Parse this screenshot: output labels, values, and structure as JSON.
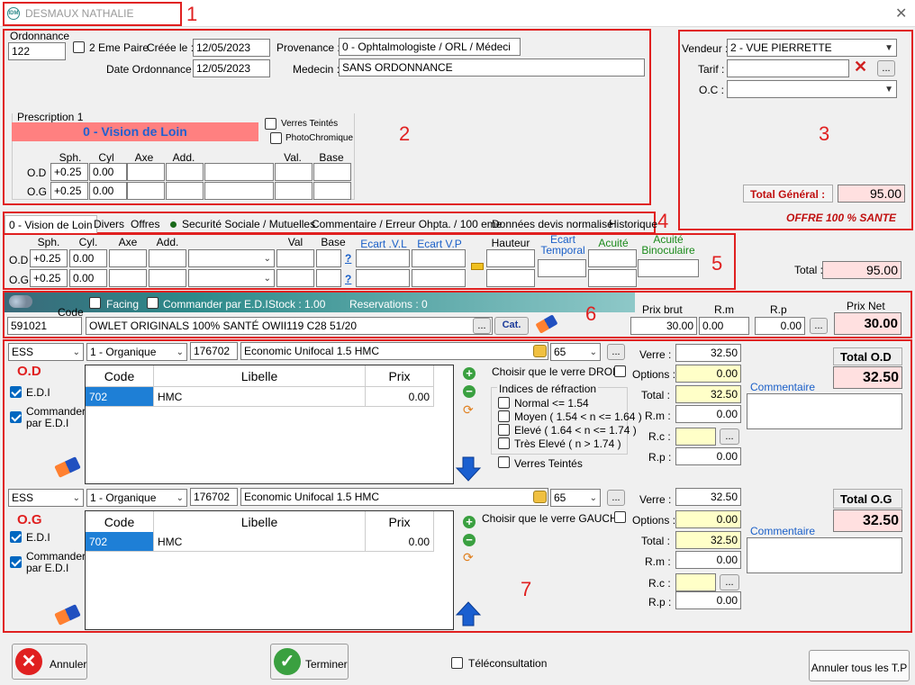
{
  "window": {
    "title": "DESMAUX NATHALIE",
    "logo": "IDM",
    "close": "✕"
  },
  "callouts": [
    "1",
    "2",
    "3",
    "4",
    "5",
    "6",
    "7"
  ],
  "ordonnance": {
    "label": "Ordonnance",
    "number": "122",
    "deuxieme_paire": "2 Eme Paire",
    "creee_label": "Créée le :",
    "creee_value": "12/05/2023",
    "date_label": "Date Ordonnance :",
    "date_value": "12/05/2023",
    "provenance_label": "Provenance :",
    "provenance_value": "0 - Ophtalmologiste / ORL / Médeci",
    "medecin_label": "Medecin :",
    "medecin_value": "SANS ORDONNANCE"
  },
  "prescription": {
    "title": "Prescription 1",
    "vision": "0 - Vision de Loin",
    "verres_teintes": "Verres Teintés",
    "photochromique": "PhotoChromique",
    "headers": {
      "sph": "Sph.",
      "cyl": "Cyl",
      "axe": "Axe",
      "add": "Add.",
      "val": "Val.",
      "base": "Base"
    },
    "od_label": "O.D",
    "og_label": "O.G",
    "od": {
      "sph": "+0.25",
      "cyl": "0.00"
    },
    "og": {
      "sph": "+0.25",
      "cyl": "0.00"
    }
  },
  "vendeur": {
    "vendeur_label": "Vendeur :",
    "vendeur_value": "2 - VUE PIERRETTE",
    "tarif_label": "Tarif :",
    "tarif_value": "",
    "oc_label": "O.C :",
    "oc_value": "",
    "total_label": "Total Général :",
    "total_value": "95.00",
    "offre": "OFFRE 100 % SANTE"
  },
  "tabs": [
    "0 - Vision de Loin",
    "Divers",
    "Offres",
    "Securité Sociale / Mutuelles",
    "Commentaire / Erreur Ohpta. / 100 eme",
    "Données devis normalisé",
    "Historique"
  ],
  "mesures": {
    "headers": {
      "sph": "Sph.",
      "cyl": "Cyl.",
      "axe": "Axe",
      "add": "Add.",
      "val": "Val",
      "base": "Base",
      "ecart_vl": "Ecart .V.L",
      "ecart_vp": "Ecart V.P",
      "hauteur": "Hauteur",
      "ecart_temporal": "Ecart Temporal",
      "acuite": "Acuité",
      "acuite_bino": "Acuité Binoculaire"
    },
    "od_label": "O.D",
    "og_label": "O.G",
    "od": {
      "sph": "+0.25",
      "cyl": "0.00"
    },
    "og": {
      "sph": "+0.25",
      "cyl": "0.00"
    },
    "help": "?",
    "total_label": "Total :",
    "total_value": "95.00"
  },
  "monture": {
    "facing": "Facing",
    "commander_edi": "Commander par E.D.I",
    "stock": "Stock : 1.00",
    "reservations": "Reservations : 0",
    "code_label": "Code",
    "code": "591021",
    "libelle": "OWLET ORIGINALS 100% SANTÉ OWII119  C28 51/20",
    "dots": "...",
    "cat": "Cat.",
    "prix_brut_label": "Prix brut",
    "rm_label": "R.m",
    "rp_label": "R.p",
    "prix_net_label": "Prix Net",
    "prix_brut": "30.00",
    "rm": "0.00",
    "rp": "0.00",
    "prix_net": "30.00"
  },
  "od": {
    "eye_label": "O.D",
    "edi": "E.D.I",
    "commander": "Commander par E.D.I",
    "type": "ESS",
    "matiere": "1 - Organique",
    "code": "176702",
    "libelle": "Economic Unifocal 1.5 HMC",
    "diam": "65",
    "grid_headers": [
      "Code",
      "Libelle",
      "Prix"
    ],
    "grid_rows": [
      {
        "code": "702",
        "libelle": "HMC",
        "prix": "0.00"
      }
    ],
    "choisir": "Choisir que le verre DROIT",
    "indices_title": "Indices de réfraction",
    "indices": [
      "Normal <= 1.54",
      "Moyen ( 1.54 < n <= 1.64 )",
      "Elevé ( 1.64 < n <= 1.74 )",
      "Très Elevé  ( n > 1.74 )"
    ],
    "verres_teintes": "Verres Teintés",
    "verre_label": "Verre :",
    "options_label": "Options :",
    "total_label": "Total :",
    "rm_label": "R.m :",
    "rc_label": "R.c :",
    "rp_label": "R.p :",
    "verre": "32.50",
    "options": "0.00",
    "total": "32.50",
    "rm": "0.00",
    "rc": "",
    "rp": "0.00",
    "total_box_label": "Total O.D",
    "total_box_value": "32.50",
    "commentaire": "Commentaire"
  },
  "og": {
    "eye_label": "O.G",
    "edi": "E.D.I",
    "commander": "Commander par E.D.I",
    "type": "ESS",
    "matiere": "1 - Organique",
    "code": "176702",
    "libelle": "Economic Unifocal 1.5 HMC",
    "diam": "65",
    "grid_headers": [
      "Code",
      "Libelle",
      "Prix"
    ],
    "grid_rows": [
      {
        "code": "702",
        "libelle": "HMC",
        "prix": "0.00"
      }
    ],
    "choisir": "Choisir que le verre GAUCHE",
    "verre_label": "Verre :",
    "options_label": "Options :",
    "total_label": "Total :",
    "rm_label": "R.m :",
    "rc_label": "R.c :",
    "rp_label": "R.p :",
    "verre": "32.50",
    "options": "0.00",
    "total": "32.50",
    "rm": "0.00",
    "rc": "",
    "rp": "0.00",
    "total_box_label": "Total O.G",
    "total_box_value": "32.50",
    "commentaire": "Commentaire"
  },
  "footer": {
    "annuler": "Annuler",
    "terminer": "Terminer",
    "teleconsultation": "Téléconsultation",
    "annuler_tp": "Annuler tous les T.P"
  },
  "colors": {
    "accent_red": "#e02020",
    "vision_bar": "#ff8080",
    "vision_text": "#2060d0",
    "teal": "#2d8a8a"
  }
}
